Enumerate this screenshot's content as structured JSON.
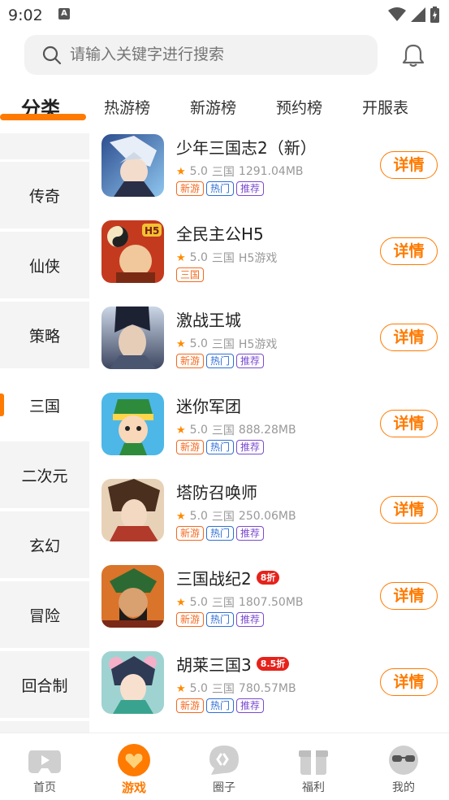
{
  "status_bar": {
    "time": "9:02",
    "notification_glyph": "A"
  },
  "search": {
    "placeholder": "请输入关键字进行搜索"
  },
  "tabs": [
    {
      "label": "分类",
      "active": true
    },
    {
      "label": "热游榜"
    },
    {
      "label": "新游榜"
    },
    {
      "label": "预约榜"
    },
    {
      "label": "开服表"
    }
  ],
  "sidebar": [
    {
      "label": ""
    },
    {
      "label": "传奇"
    },
    {
      "label": "仙侠"
    },
    {
      "label": "策略"
    },
    {
      "label": "三国",
      "active": true
    },
    {
      "label": "二次元"
    },
    {
      "label": "玄幻"
    },
    {
      "label": "冒险"
    },
    {
      "label": "回合制"
    }
  ],
  "games": [
    {
      "title": "少年三国志2（新）",
      "rating": "5.0",
      "category": "三国",
      "size": "1291.04MB",
      "tags": [
        "新游",
        "热门",
        "推荐"
      ],
      "button": "详情"
    },
    {
      "title": "全民主公H5",
      "rating": "5.0",
      "category": "三国",
      "size": "H5游戏",
      "tags": [
        "三国"
      ],
      "button": "详情"
    },
    {
      "title": "激战王城",
      "rating": "5.0",
      "category": "三国",
      "size": "H5游戏",
      "tags": [
        "新游",
        "热门",
        "推荐"
      ],
      "button": "详情"
    },
    {
      "title": "迷你军团",
      "rating": "5.0",
      "category": "三国",
      "size": "888.28MB",
      "tags": [
        "新游",
        "热门",
        "推荐"
      ],
      "button": "详情"
    },
    {
      "title": "塔防召唤师",
      "rating": "5.0",
      "category": "三国",
      "size": "250.06MB",
      "tags": [
        "新游",
        "热门",
        "推荐"
      ],
      "button": "详情"
    },
    {
      "title": "三国战纪2",
      "discount": "8折",
      "rating": "5.0",
      "category": "三国",
      "size": "1807.50MB",
      "tags": [
        "新游",
        "热门",
        "推荐"
      ],
      "button": "详情"
    },
    {
      "title": "胡莱三国3",
      "discount": "8.5折",
      "rating": "5.0",
      "category": "三国",
      "size": "780.57MB",
      "tags": [
        "新游",
        "热门",
        "推荐"
      ],
      "button": "详情"
    }
  ],
  "bottom_nav": [
    {
      "label": "首页",
      "icon": "gamepad-icon"
    },
    {
      "label": "游戏",
      "icon": "game-heart-icon",
      "active": true
    },
    {
      "label": "圈子",
      "icon": "chat-bubble-icon"
    },
    {
      "label": "福利",
      "icon": "gift-icon"
    },
    {
      "label": "我的",
      "icon": "profile-sunglasses-icon"
    }
  ],
  "colors": {
    "accent": "#ff7a00",
    "tag_orange": "#f4691f",
    "tag_blue": "#2f6fd6",
    "tag_purple": "#7b4bd0",
    "discount": "#e6221b"
  }
}
